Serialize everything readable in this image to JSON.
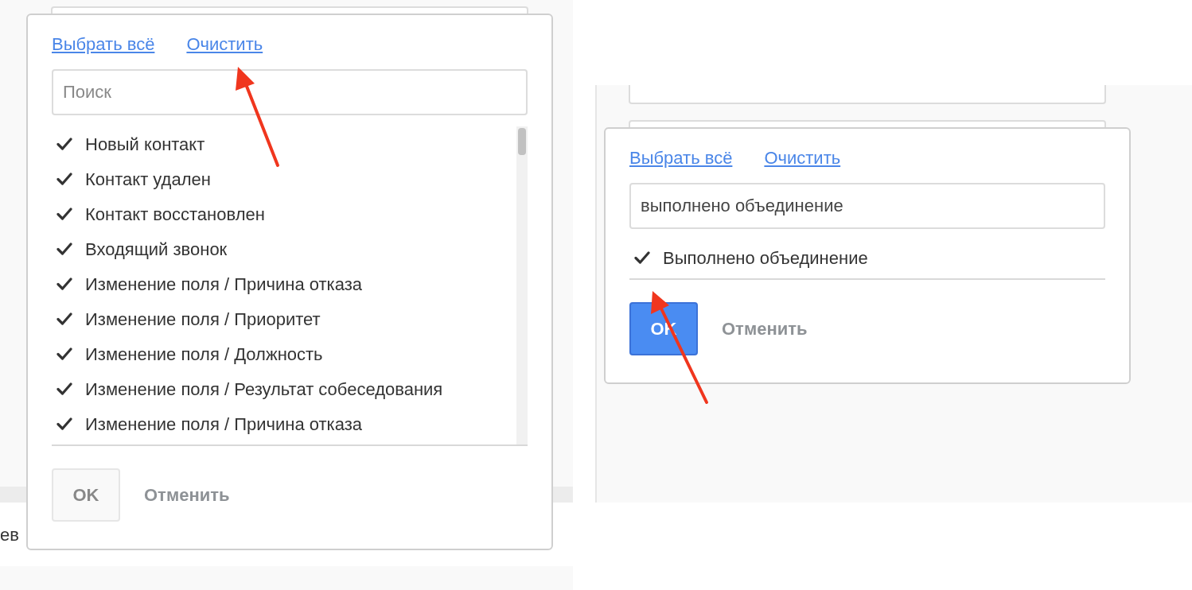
{
  "panels": [
    {
      "background_text": "ев",
      "popup": {
        "select_all": "Выбрать всё",
        "clear": "Очистить",
        "search": {
          "placeholder": "Поиск"
        },
        "scrollable": true,
        "items": [
          {
            "label": "Новый контакт",
            "checked": true
          },
          {
            "label": "Контакт удален",
            "checked": true
          },
          {
            "label": "Контакт восстановлен",
            "checked": true
          },
          {
            "label": "Входящий звонок",
            "checked": true
          },
          {
            "label": "Изменение поля / Причина отказа",
            "checked": true
          },
          {
            "label": "Изменение поля / Приоритет",
            "checked": true
          },
          {
            "label": "Изменение поля / Должность",
            "checked": true
          },
          {
            "label": "Изменение поля / Результат собеседования",
            "checked": true
          },
          {
            "label": "Изменение поля / Причина отказа",
            "checked": true
          }
        ],
        "ok": {
          "label": "OK",
          "disabled": true
        },
        "cancel": "Отменить"
      }
    },
    {
      "popup": {
        "select_all": "Выбрать всё",
        "clear": "Очистить",
        "search": {
          "value": "выполнено объединение"
        },
        "scrollable": false,
        "items": [
          {
            "label": "Выполнено объединение",
            "checked": true
          }
        ],
        "ok": {
          "label": "OK",
          "disabled": false
        },
        "cancel": "Отменить"
      }
    }
  ]
}
